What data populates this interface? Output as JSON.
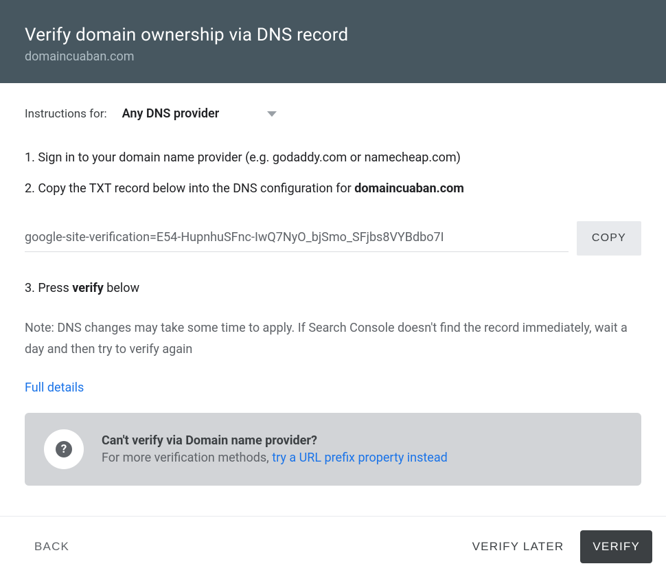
{
  "header": {
    "title": "Verify domain ownership via DNS record",
    "subtitle": "domaincuaban.com"
  },
  "instructions": {
    "label": "Instructions for:",
    "selected_provider": "Any DNS provider"
  },
  "steps": {
    "step1": "1. Sign in to your domain name provider (e.g. godaddy.com or namecheap.com)",
    "step2_prefix": "2. Copy the TXT record below into the DNS configuration for ",
    "step2_domain": "domaincuaban.com",
    "step3_prefix": "3. Press ",
    "step3_bold": "verify",
    "step3_suffix": " below"
  },
  "txt_record": {
    "value": "google-site-verification=E54-HupnhuSFnc-IwQ7NyO_bjSmo_SFjbs8VYBdbo7I",
    "copy_label": "COPY"
  },
  "note": "Note: DNS changes may take some time to apply. If Search Console doesn't find the record immediately, wait a day and then try to verify again",
  "full_details_label": "Full details",
  "alt_box": {
    "title": "Can't verify via Domain name provider?",
    "body_prefix": "For more verification methods, ",
    "link": "try a URL prefix property instead"
  },
  "footer": {
    "back_label": "BACK",
    "verify_later_label": "VERIFY LATER",
    "verify_label": "VERIFY"
  }
}
